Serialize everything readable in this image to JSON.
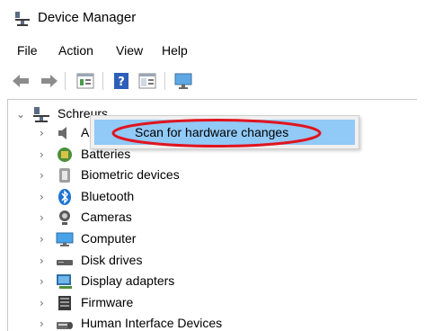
{
  "window": {
    "title": "Device Manager",
    "icon": "device-manager-icon"
  },
  "menu": {
    "items": [
      "File",
      "Action",
      "View",
      "Help"
    ]
  },
  "toolbar": {
    "buttons": [
      "back-arrow-icon",
      "forward-arrow-icon",
      "properties-icon",
      "help-icon",
      "show-hide-console-tree-icon",
      "scan-monitor-icon"
    ]
  },
  "tree": {
    "root": {
      "label": "Schreurs",
      "expanded": true,
      "icon": "computer-network-icon"
    },
    "children": [
      {
        "label": "Au",
        "icon": "speaker-icon"
      },
      {
        "label": "Batteries",
        "icon": "battery-icon"
      },
      {
        "label": "Biometric devices",
        "icon": "fingerprint-icon"
      },
      {
        "label": "Bluetooth",
        "icon": "bluetooth-icon"
      },
      {
        "label": "Cameras",
        "icon": "camera-icon"
      },
      {
        "label": "Computer",
        "icon": "monitor-icon"
      },
      {
        "label": "Disk drives",
        "icon": "disk-drive-icon"
      },
      {
        "label": "Display adapters",
        "icon": "display-adapter-icon"
      },
      {
        "label": "Firmware",
        "icon": "firmware-icon"
      },
      {
        "label": "Human Interface Devices",
        "icon": "hid-icon"
      }
    ]
  },
  "context_menu": {
    "items": [
      {
        "label": "Scan for hardware changes",
        "highlighted": true
      }
    ]
  },
  "colors": {
    "menu_highlight": "#91c9f7",
    "annotation": "#e0141e"
  }
}
